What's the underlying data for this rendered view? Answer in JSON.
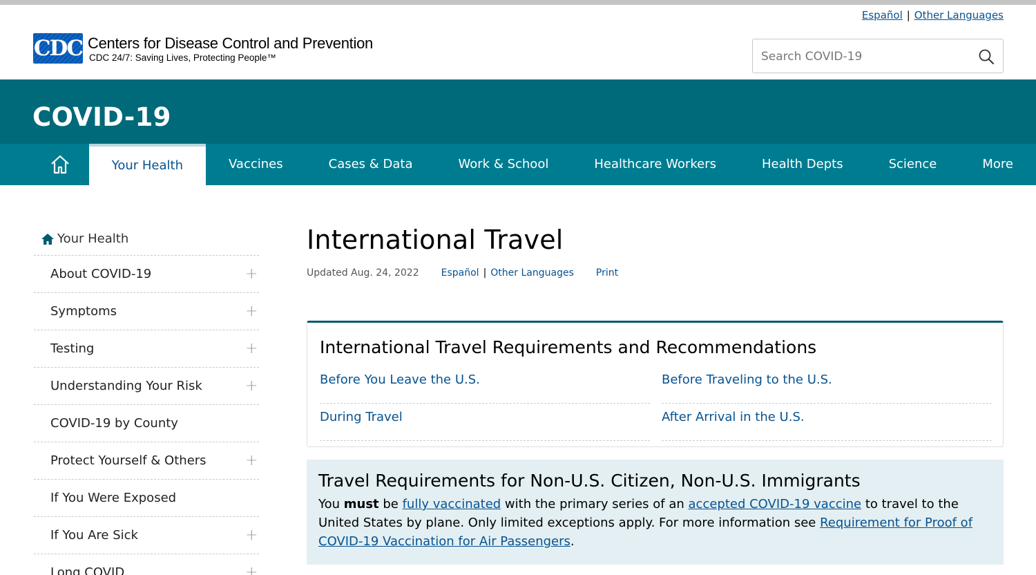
{
  "header": {
    "lang_spanish": "Español",
    "lang_sep": "|",
    "lang_other": "Other Languages",
    "logo_text": "CDC",
    "org_name": "Centers for Disease Control and Prevention",
    "org_tagline": "CDC 24/7: Saving Lives, Protecting People™",
    "search_placeholder": "Search COVID-19"
  },
  "banner": {
    "title": "COVID-19"
  },
  "nav": {
    "items": [
      "Your Health",
      "Vaccines",
      "Cases & Data",
      "Work & School",
      "Healthcare Workers",
      "Health Depts",
      "Science",
      "More"
    ],
    "active": "Your Health"
  },
  "sidebar": {
    "heading": "Your Health",
    "items": [
      {
        "label": "About COVID-19",
        "expand": "+"
      },
      {
        "label": "Symptoms",
        "expand": "+"
      },
      {
        "label": "Testing",
        "expand": "+"
      },
      {
        "label": "Understanding Your Risk",
        "expand": "+"
      },
      {
        "label": "COVID-19 by County",
        "expand": ""
      },
      {
        "label": "Protect Yourself & Others",
        "expand": "+"
      },
      {
        "label": "If You Were Exposed",
        "expand": ""
      },
      {
        "label": "If You Are Sick",
        "expand": "+"
      },
      {
        "label": "Long COVID",
        "expand": "+"
      }
    ]
  },
  "main": {
    "title": "International Travel",
    "updated": "Updated Aug. 24, 2022",
    "lang_spanish": "Español",
    "lang_sep": "|",
    "lang_other": "Other Languages",
    "print": "Print",
    "card": {
      "title": "International Travel Requirements and Recommendations",
      "links": [
        "Before You Leave the U.S.",
        "Before Traveling to the U.S.",
        "During Travel",
        "After Arrival in the U.S."
      ]
    },
    "note": {
      "title": "Travel Requirements for Non-U.S. Citizen, Non-U.S. Immigrants",
      "t1": "You ",
      "t2": "must",
      "t3": " be ",
      "link1": "fully vaccinated",
      "t4": " with the primary series of an ",
      "link2": "accepted COVID-19 vaccine",
      "t5": " to travel to the United States by plane. Only limited exceptions apply. For more information see ",
      "link3": "Requirement for Proof of COVID-19 Vaccination for Air Passengers",
      "t6": "."
    }
  },
  "colors": {
    "banner": "#00697a",
    "nav": "#007c91",
    "link": "#075290",
    "note_bg": "#e3eff2",
    "logo": "#0057b7"
  }
}
